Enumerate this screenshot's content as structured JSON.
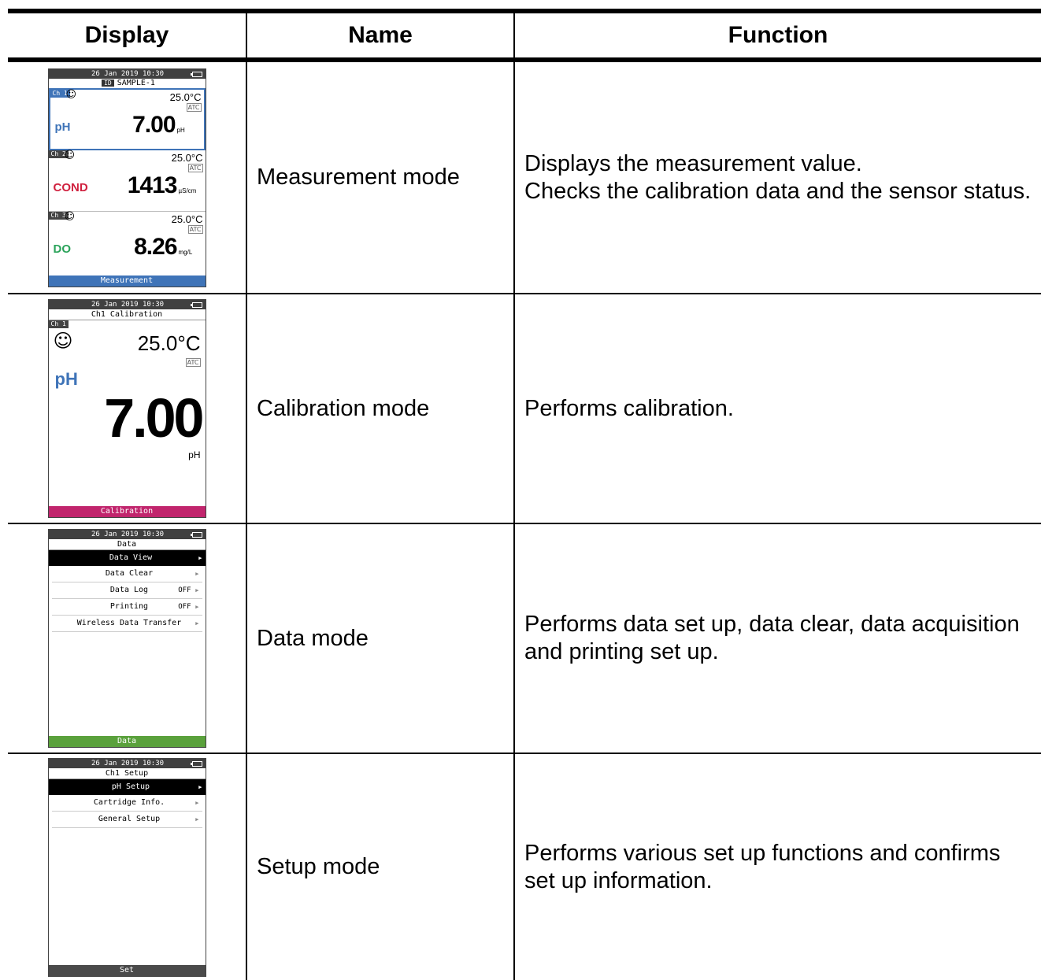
{
  "headers": {
    "display": "Display",
    "name": "Name",
    "function": "Function"
  },
  "screens": {
    "datetime": "26 Jan 2019 10:30",
    "measurement": {
      "id_tag": "ID",
      "id_value": "SAMPLE-1",
      "atc": "ATC",
      "channels": [
        {
          "tag": "Ch 1",
          "param": "pH",
          "param_color": "#3f74b8",
          "temp": "25.0°C",
          "value": "7.00",
          "unit": "pH"
        },
        {
          "tag": "Ch 2",
          "param": "COND",
          "param_color": "#d0213f",
          "temp": "25.0°C",
          "value": "1413",
          "unit": "µS/cm"
        },
        {
          "tag": "Ch 3",
          "param": "DO",
          "param_color": "#2aa35a",
          "temp": "25.0°C",
          "value": "8.26",
          "unit": "mg/L"
        }
      ],
      "footer": "Measurement",
      "footer_color": "#3f74b8"
    },
    "calibration": {
      "title": "Ch1 Calibration",
      "ch_tag": "Ch 1",
      "temp": "25.0°C",
      "atc": "ATC",
      "param": "pH",
      "value": "7.00",
      "unit": "pH",
      "footer": "Calibration",
      "footer_color": "#c1256d"
    },
    "data": {
      "title": "Data",
      "items": [
        {
          "label": "Data View",
          "value": ""
        },
        {
          "label": "Data Clear",
          "value": ""
        },
        {
          "label": "Data Log",
          "value": "OFF"
        },
        {
          "label": "Printing",
          "value": "OFF"
        },
        {
          "label": "Wireless Data Transfer",
          "value": ""
        }
      ],
      "footer": "Data",
      "footer_color": "#5aa13c"
    },
    "setup": {
      "title": "Ch1 Setup",
      "items": [
        {
          "label": "pH Setup",
          "value": ""
        },
        {
          "label": "Cartridge Info.",
          "value": ""
        },
        {
          "label": "General Setup",
          "value": ""
        }
      ],
      "footer": "Set",
      "footer_color": "#4a4a4a"
    }
  },
  "rows": [
    {
      "name": "Measurement mode",
      "function": [
        "Displays the measurement value.",
        "Checks the calibration data and the sensor status."
      ]
    },
    {
      "name": "Calibration mode",
      "function": [
        "Performs calibration."
      ]
    },
    {
      "name": "Data mode",
      "function": [
        "Performs data set up, data clear, data acquisition and printing set up."
      ]
    },
    {
      "name": "Setup mode",
      "function": [
        "Performs various set up functions and confirms set up information."
      ]
    }
  ]
}
